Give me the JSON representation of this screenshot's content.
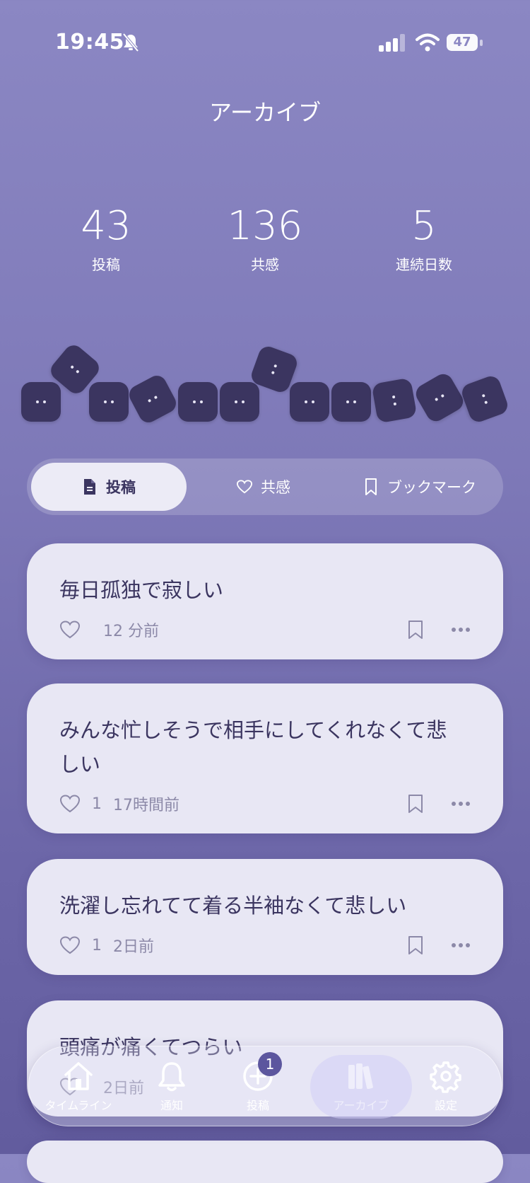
{
  "status_bar": {
    "time": "19:45",
    "battery": "47"
  },
  "header": {
    "title": "アーカイブ"
  },
  "stats": [
    {
      "value": "43",
      "label": "投稿"
    },
    {
      "value": "136",
      "label": "共感"
    },
    {
      "value": "5",
      "label": "連続日数"
    }
  ],
  "tabs": [
    {
      "label": "投稿",
      "icon": "document-icon",
      "active": true
    },
    {
      "label": "共感",
      "icon": "heart-icon",
      "active": false
    },
    {
      "label": "ブックマーク",
      "icon": "bookmark-icon",
      "active": false
    }
  ],
  "posts": [
    {
      "text": "毎日孤独で寂しい",
      "likes": "",
      "time": "12 分前"
    },
    {
      "text": "みんな忙しそうで相手にしてくれなくて悲しい",
      "likes": "1",
      "time": "17時間前"
    },
    {
      "text": "洗濯し忘れてて着る半袖なくて悲しい",
      "likes": "1",
      "time": "2日前"
    },
    {
      "text": "頭痛が痛くてつらい",
      "likes": "",
      "time": "2日前"
    }
  ],
  "nav": [
    {
      "label": "タイムライン",
      "icon": "home-icon"
    },
    {
      "label": "通知",
      "icon": "bell-icon"
    },
    {
      "label": "投稿",
      "icon": "plus-circle-icon",
      "badge": "1"
    },
    {
      "label": "アーカイブ",
      "icon": "books-icon",
      "active": true
    },
    {
      "label": "設定",
      "icon": "gear-icon"
    }
  ],
  "colors": {
    "accent": "#3b3560",
    "card": "#e8e7f4",
    "background": "#8b87c3"
  }
}
